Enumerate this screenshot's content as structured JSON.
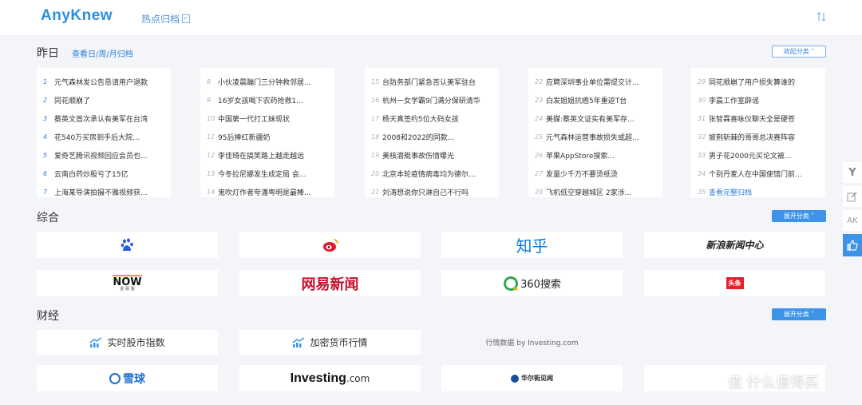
{
  "header": {
    "logo": "AnyKnew",
    "nav_label": "热点归档",
    "nav_badge": "↵"
  },
  "yesterday": {
    "title": "昨日",
    "sub_link": "查看日/周/月归档",
    "collapse_label": "收起分类",
    "columns": [
      {
        "items": [
          {
            "rank": "1",
            "title": "元气森林发公告恳请用户退款"
          },
          {
            "rank": "2",
            "title": "同花顺崩了"
          },
          {
            "rank": "3",
            "title": "蔡英文首次承认有美军在台湾"
          },
          {
            "rank": "4",
            "title": "花540万买房到手后大院..."
          },
          {
            "rank": "5",
            "title": "爱奇艺腾讯视频回应会员也..."
          },
          {
            "rank": "6",
            "title": "云南白药炒股亏了15亿"
          },
          {
            "rank": "7",
            "title": "上海某导演拍摄不雅视频获..."
          }
        ]
      },
      {
        "items": [
          {
            "rank": "8",
            "title": "小伙凌晨蹦门三分钟救邻居..."
          },
          {
            "rank": "9",
            "title": "16岁女孩喝下农药抢救1..."
          },
          {
            "rank": "10",
            "title": "中国第一代打工妹现状"
          },
          {
            "rank": "11",
            "title": "95后捧红新疆奶"
          },
          {
            "rank": "12",
            "title": "李佳琦在搞笑路上越走越远"
          },
          {
            "rank": "13",
            "title": "今冬拉尼娜发生成定局 会..."
          },
          {
            "rank": "14",
            "title": "鬼吹灯作者夸潘粤明是最棒..."
          }
        ]
      },
      {
        "items": [
          {
            "rank": "15",
            "title": "台防务部门紧急否认美军驻台"
          },
          {
            "rank": "16",
            "title": "杭州一女学霸9门满分保研清华"
          },
          {
            "rank": "17",
            "title": "杨天真签约5位大码女孩"
          },
          {
            "rank": "18",
            "title": "2008和2022的同款..."
          },
          {
            "rank": "19",
            "title": "美核潜艇事故伤情曝光"
          },
          {
            "rank": "20",
            "title": "北京本轮疫情病毒均为德尔..."
          },
          {
            "rank": "21",
            "title": "刘涛想说你只淋自己不行吗"
          }
        ]
      },
      {
        "items": [
          {
            "rank": "22",
            "title": "应聘深圳事业单位需提交计..."
          },
          {
            "rank": "23",
            "title": "白发姐姐抗癌5年重返T台"
          },
          {
            "rank": "24",
            "title": "美媒:蔡英文证实有美军存..."
          },
          {
            "rank": "25",
            "title": "元气森林运营事故损失或超..."
          },
          {
            "rank": "26",
            "title": "苹果AppStore搜索..."
          },
          {
            "rank": "27",
            "title": "发量少千万不要烫纸烫"
          },
          {
            "rank": "28",
            "title": "飞机低空穿越城区 2家涉..."
          }
        ]
      },
      {
        "items": [
          {
            "rank": "29",
            "title": "同花顺崩了用户损失算谁的"
          },
          {
            "rank": "30",
            "title": "李晨工作室辟谣"
          },
          {
            "rank": "31",
            "title": "张智霖喜咏仪聊天全是硬苍"
          },
          {
            "rank": "32",
            "title": "披荆斩棘的哥哥总决赛阵容"
          },
          {
            "rank": "33",
            "title": "男子花2000元买论文被..."
          },
          {
            "rank": "34",
            "title": "个别丹麦人在中国使馆门前..."
          },
          {
            "rank": "35",
            "title": "查看完整归档"
          }
        ]
      }
    ]
  },
  "general": {
    "title": "综合",
    "expand_label": "展开分类",
    "tiles": [
      "百度",
      "微博",
      "知乎",
      "新浪新闻中心",
      "NOW",
      "网易新闻",
      "360搜索",
      "头条"
    ],
    "now_sub": "金 融 圈"
  },
  "finance": {
    "title": "财经",
    "expand_label": "展开分类",
    "tiles_row1": [
      "实时股市指数",
      "加密货币行情",
      "行情数据 by Investing.com"
    ],
    "tiles_row2": [
      "雪球",
      "Investing",
      ".com",
      "华尔街见闻"
    ]
  },
  "side_tools": [
    "Y",
    "edit",
    "AK",
    "thumb"
  ],
  "watermark": "值 什么值得买",
  "colors": {
    "accent": "#3d93e8",
    "link": "#2d7fd8"
  }
}
